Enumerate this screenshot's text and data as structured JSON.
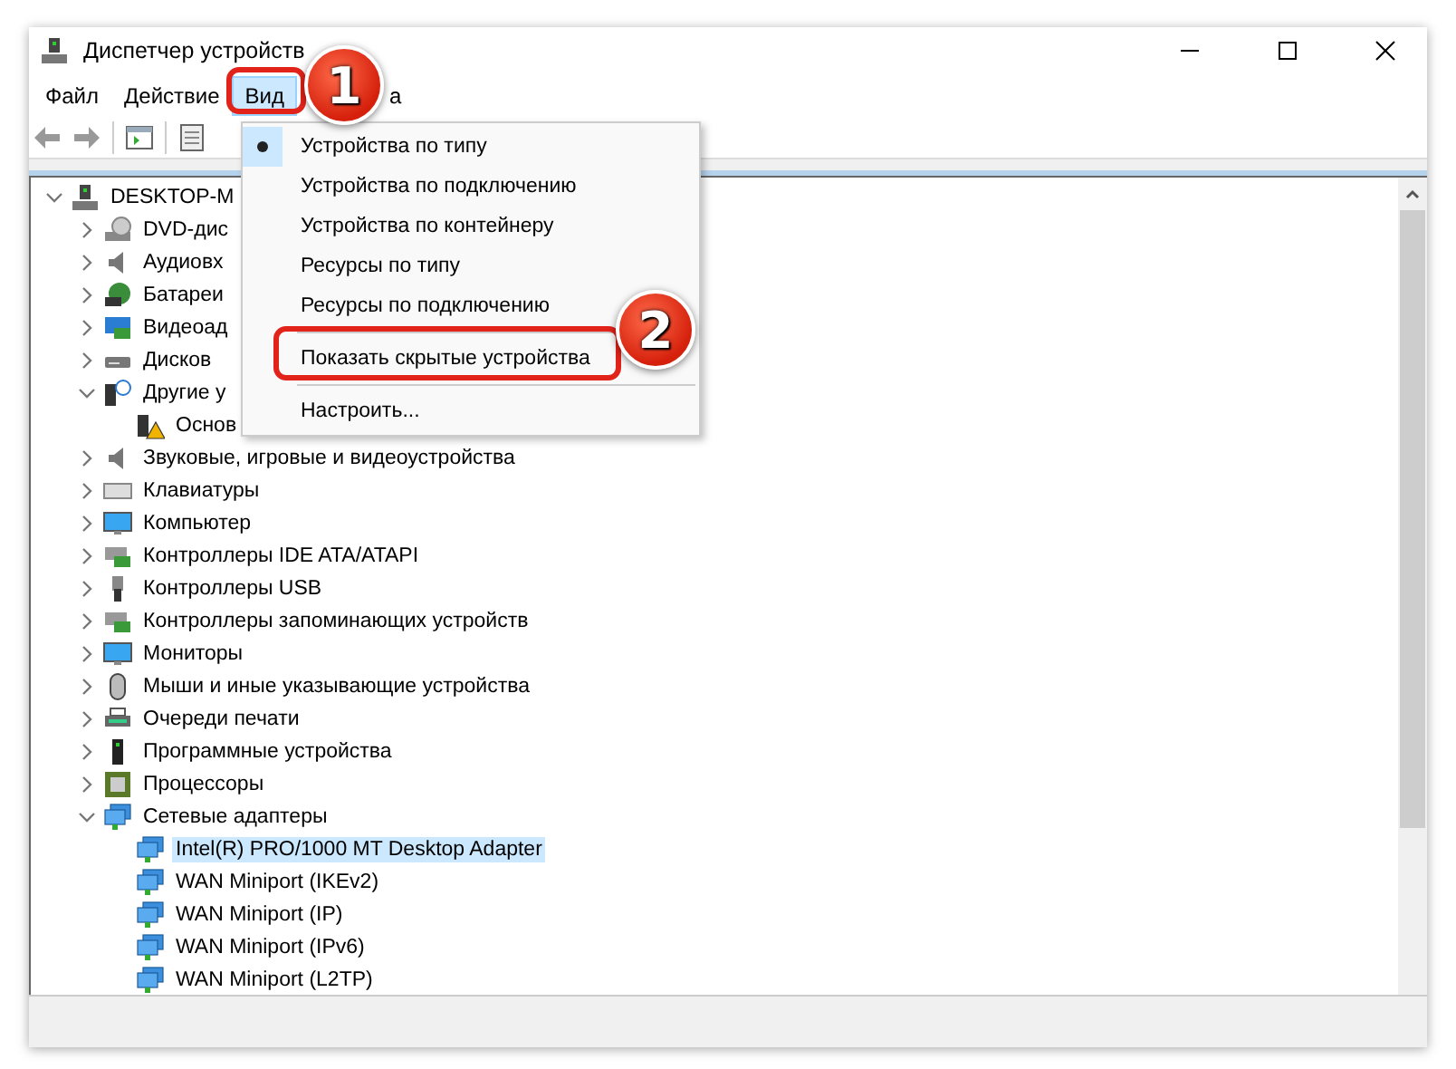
{
  "window": {
    "title": "Диспетчер устройств"
  },
  "menu_bar": [
    {
      "label": "Файл",
      "selected": false
    },
    {
      "label": "Действие",
      "selected": false
    },
    {
      "label": "Вид",
      "selected": true
    },
    {
      "label": "а",
      "selected": false
    }
  ],
  "view_menu": {
    "items": [
      {
        "kind": "radio",
        "label": "Устройства по типу",
        "selected": true
      },
      {
        "kind": "radio",
        "label": "Устройства по подключению",
        "selected": false
      },
      {
        "kind": "radio",
        "label": "Устройства по контейнеру",
        "selected": false
      },
      {
        "kind": "radio",
        "label": "Ресурсы по типу",
        "selected": false
      },
      {
        "kind": "radio",
        "label": "Ресурсы по подключению",
        "selected": false
      },
      {
        "kind": "separator"
      },
      {
        "kind": "command",
        "label": "Показать скрытые устройства"
      },
      {
        "kind": "separator"
      },
      {
        "kind": "command",
        "label": "Настроить..."
      }
    ]
  },
  "device_tree": {
    "label": "DESKTOP-M",
    "kind": "computer",
    "expanded": true,
    "selected": false,
    "children": [
      {
        "label": "DVD-дис",
        "kind": "dvd",
        "expanded": false,
        "selected": false
      },
      {
        "label": "Аудиовх",
        "kind": "audio",
        "expanded": false,
        "selected": false
      },
      {
        "label": "Батареи",
        "kind": "battery",
        "expanded": false,
        "selected": false
      },
      {
        "label": "Видеоад",
        "kind": "display",
        "expanded": false,
        "selected": false
      },
      {
        "label": "Дисков",
        "kind": "disk",
        "expanded": false,
        "selected": false
      },
      {
        "label": "Другие у",
        "kind": "other",
        "expanded": true,
        "selected": false,
        "children": [
          {
            "label": "Основ",
            "kind": "warning",
            "selected": false
          }
        ]
      },
      {
        "label": "Звуковые, игровые и видеоустройства",
        "kind": "audio",
        "expanded": false,
        "selected": false
      },
      {
        "label": "Клавиатуры",
        "kind": "keyboard",
        "expanded": false,
        "selected": false
      },
      {
        "label": "Компьютер",
        "kind": "monitor",
        "expanded": false,
        "selected": false
      },
      {
        "label": "Контроллеры IDE ATA/ATAPI",
        "kind": "ide",
        "expanded": false,
        "selected": false
      },
      {
        "label": "Контроллеры USB",
        "kind": "usb",
        "expanded": false,
        "selected": false
      },
      {
        "label": "Контроллеры запоминающих устройств",
        "kind": "ide",
        "expanded": false,
        "selected": false
      },
      {
        "label": "Мониторы",
        "kind": "monitor",
        "expanded": false,
        "selected": false
      },
      {
        "label": "Мыши и иные указывающие устройства",
        "kind": "mouse",
        "expanded": false,
        "selected": false
      },
      {
        "label": "Очереди печати",
        "kind": "printer",
        "expanded": false,
        "selected": false
      },
      {
        "label": "Программные устройства",
        "kind": "firmware",
        "expanded": false,
        "selected": false
      },
      {
        "label": "Процессоры",
        "kind": "cpu",
        "expanded": false,
        "selected": false
      },
      {
        "label": "Сетевые адаптеры",
        "kind": "network",
        "expanded": true,
        "selected": false,
        "children": [
          {
            "label": "Intel(R) PRO/1000 MT Desktop Adapter",
            "kind": "network",
            "selected": true
          },
          {
            "label": "WAN Miniport (IKEv2)",
            "kind": "network",
            "selected": false
          },
          {
            "label": "WAN Miniport (IP)",
            "kind": "network",
            "selected": false
          },
          {
            "label": "WAN Miniport (IPv6)",
            "kind": "network",
            "selected": false
          },
          {
            "label": "WAN Miniport (L2TP)",
            "kind": "network",
            "selected": false
          }
        ]
      }
    ]
  },
  "annotations": [
    {
      "label": "1"
    },
    {
      "label": "2"
    }
  ]
}
